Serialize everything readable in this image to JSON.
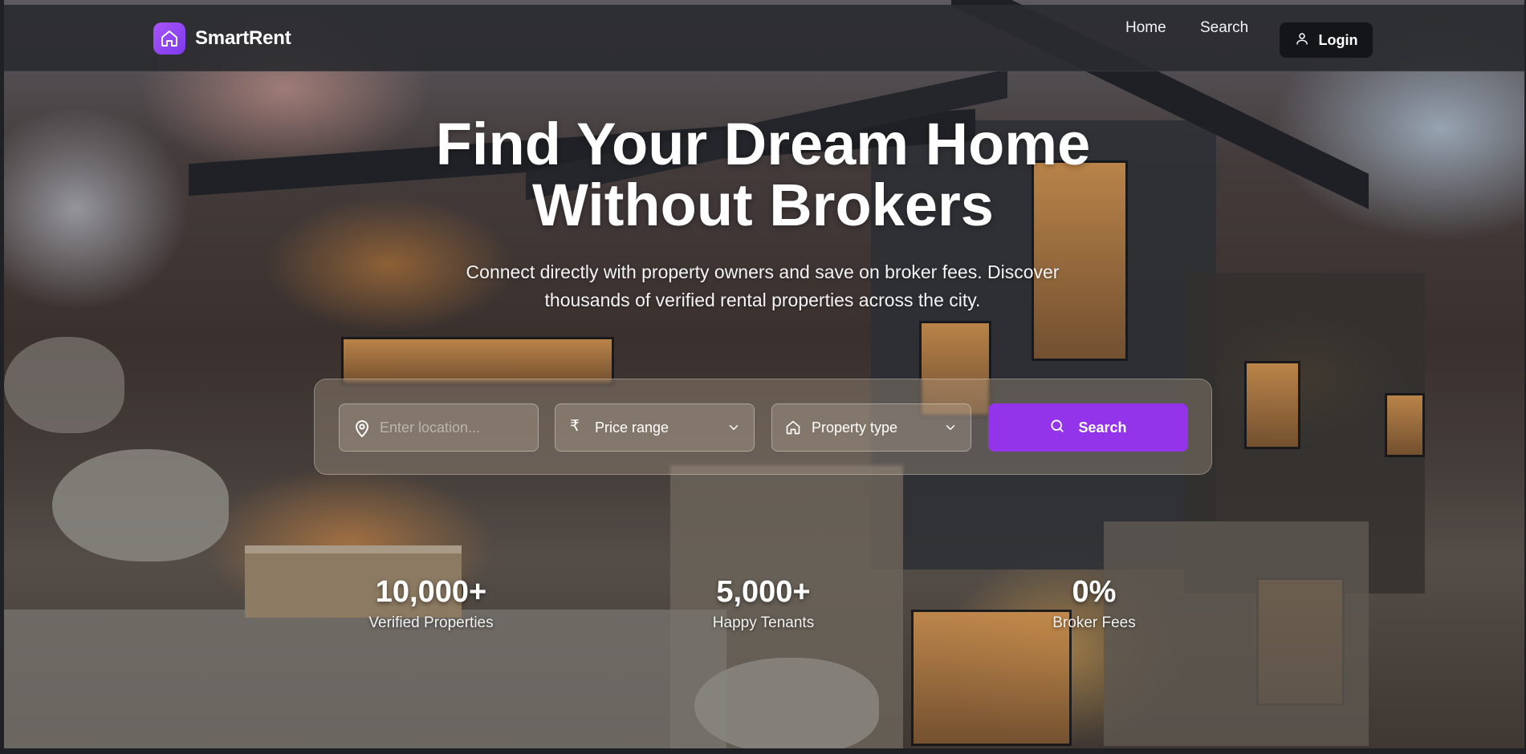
{
  "header": {
    "brand_name": "SmartRent",
    "nav": {
      "home_label": "Home",
      "search_label": "Search",
      "login_label": "Login"
    }
  },
  "hero": {
    "title_line1": "Find Your Dream Home",
    "title_line2": "Without Brokers",
    "subtitle_line1": "Connect directly with property owners and save on broker fees. Discover",
    "subtitle_line2": "thousands of verified rental properties across the city."
  },
  "search": {
    "location_placeholder": "Enter location...",
    "price_label": "Price range",
    "price_icon": "rupee-icon",
    "type_label": "Property type",
    "type_icon": "home-icon",
    "button_label": "Search"
  },
  "stats": [
    {
      "value": "10,000+",
      "label": "Verified Properties"
    },
    {
      "value": "5,000+",
      "label": "Happy Tenants"
    },
    {
      "value": "0%",
      "label": "Broker Fees"
    }
  ],
  "colors": {
    "accent": "#9333ea",
    "logo_gradient_start": "#a855f7",
    "logo_gradient_end": "#7c3aed",
    "header_bg": "#2a2b30",
    "login_bg": "#141518"
  }
}
